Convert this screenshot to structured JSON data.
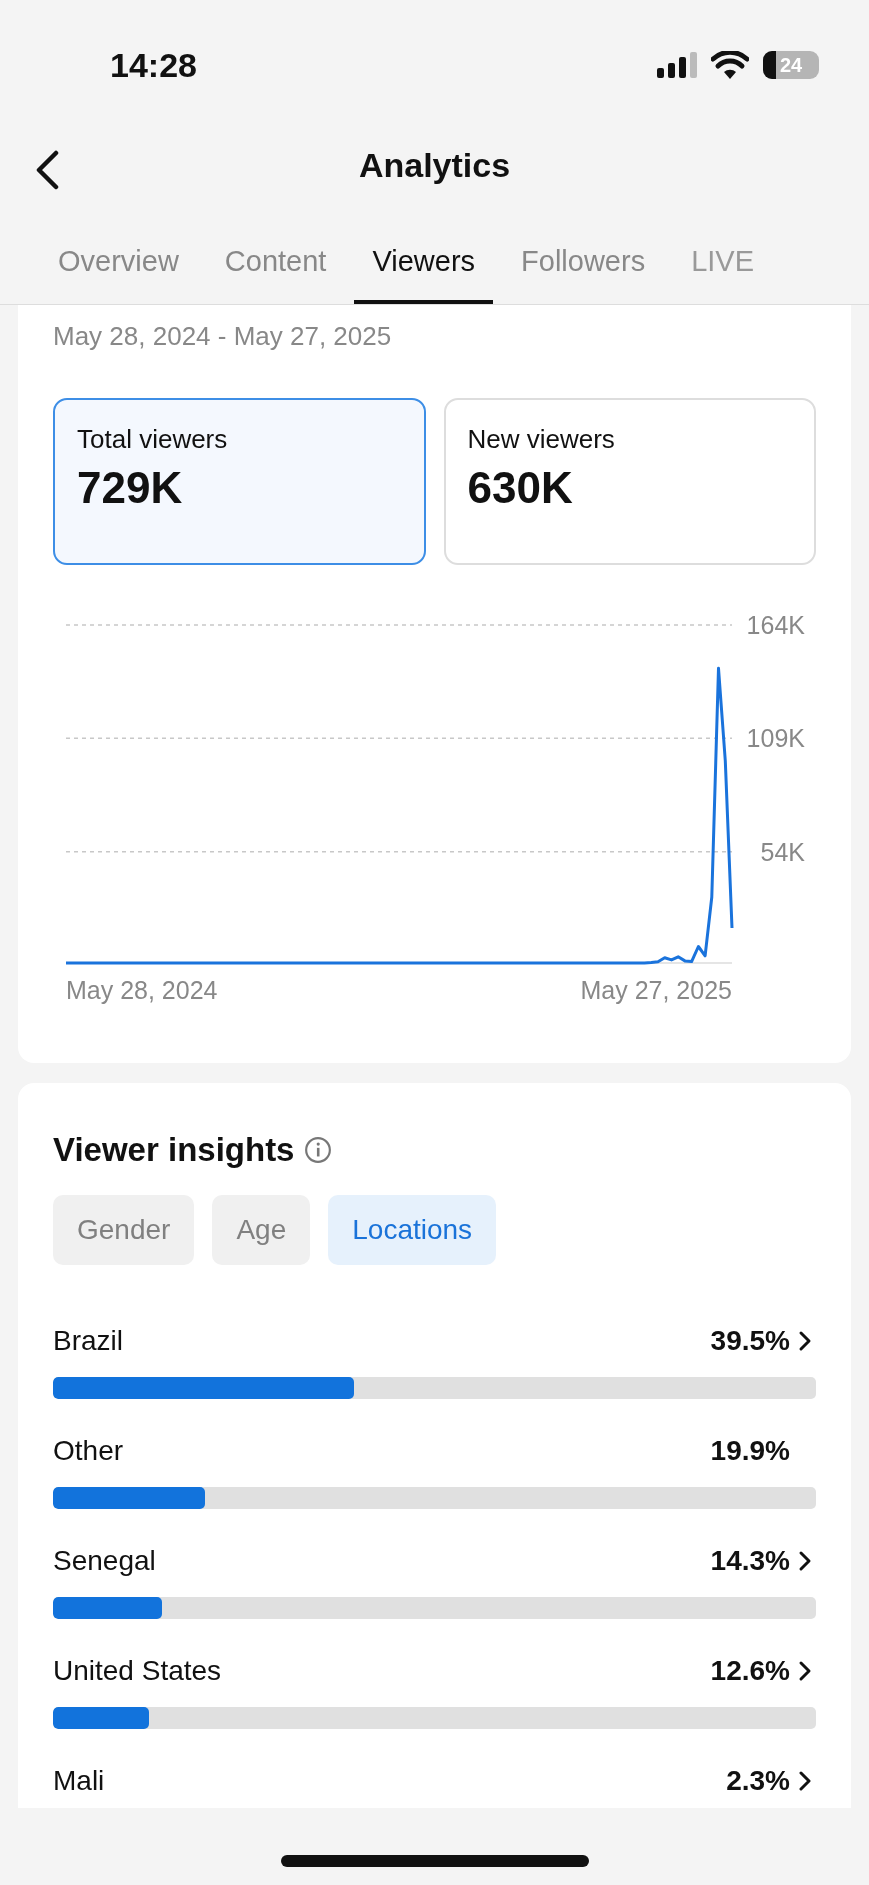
{
  "status_bar": {
    "time": "14:28",
    "battery": "24"
  },
  "header": {
    "title": "Analytics"
  },
  "tabs": [
    {
      "label": "Overview",
      "selected": false
    },
    {
      "label": "Content",
      "selected": false
    },
    {
      "label": "Viewers",
      "selected": true
    },
    {
      "label": "Followers",
      "selected": false
    },
    {
      "label": "LIVE",
      "selected": false
    }
  ],
  "key_metrics": {
    "date_range": "May 28, 2024 - May 27, 2025",
    "metrics": [
      {
        "label": "Total viewers",
        "value": "729K",
        "selected": true
      },
      {
        "label": "New viewers",
        "value": "630K",
        "selected": false
      }
    ],
    "x_axis_labels": [
      "May 28, 2024",
      "May 27, 2025"
    ],
    "chart_data": {
      "type": "line",
      "ylim": [
        0,
        164000
      ],
      "yticks": [
        {
          "value": 54000,
          "label": "54K"
        },
        {
          "value": 109000,
          "label": "109K"
        },
        {
          "value": 164000,
          "label": "164K"
        }
      ],
      "series": [
        {
          "color": "#1a73dc",
          "values": [
            0,
            0,
            0,
            0,
            0,
            0,
            0,
            0,
            0,
            0,
            0,
            0,
            0,
            0,
            0,
            0,
            0,
            0,
            0,
            0,
            0,
            0,
            0,
            0,
            0,
            0,
            0,
            0,
            0,
            0,
            0,
            0,
            0,
            0,
            0,
            0,
            0,
            0,
            0,
            0,
            0,
            0,
            0,
            0,
            0,
            0,
            0,
            0,
            0,
            0,
            0,
            0,
            0,
            0,
            0,
            0,
            0,
            0,
            0,
            0,
            0,
            0,
            0,
            0,
            0,
            0,
            0,
            0,
            0,
            0,
            0,
            0,
            0,
            0,
            0,
            0,
            0,
            0,
            0,
            0,
            0,
            0,
            0,
            0,
            0,
            0,
            0,
            200,
            600,
            2500,
            1500,
            3000,
            1000,
            700,
            8000,
            3500,
            32000,
            143000,
            98000,
            17000
          ]
        }
      ]
    }
  },
  "viewer_insights": {
    "title": "Viewer insights",
    "filters": [
      {
        "label": "Gender",
        "selected": false
      },
      {
        "label": "Age",
        "selected": false
      },
      {
        "label": "Locations",
        "selected": true
      }
    ],
    "locations": [
      {
        "name": "Brazil",
        "percent": "39.5%",
        "level": 0.395,
        "chevron": true
      },
      {
        "name": "Other",
        "percent": "19.9%",
        "level": 0.199,
        "chevron": false
      },
      {
        "name": "Senegal",
        "percent": "14.3%",
        "level": 0.143,
        "chevron": true
      },
      {
        "name": "United States",
        "percent": "12.6%",
        "level": 0.126,
        "chevron": true
      },
      {
        "name": "Mali",
        "percent": "2.3%",
        "chevron": true
      }
    ]
  }
}
